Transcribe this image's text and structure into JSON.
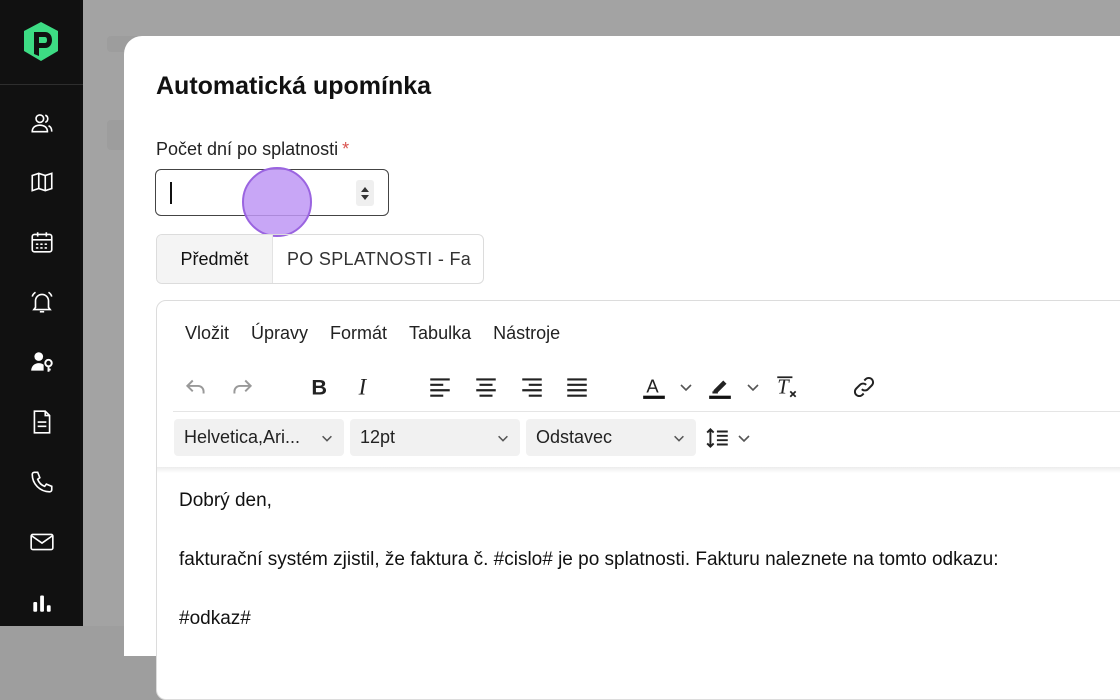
{
  "sidebar": {
    "logo": "logo-mark",
    "items": [
      {
        "icon": "users-icon"
      },
      {
        "icon": "map-icon"
      },
      {
        "icon": "calendar-icon"
      },
      {
        "icon": "bell-icon"
      },
      {
        "icon": "user-key-icon"
      },
      {
        "icon": "document-icon"
      },
      {
        "icon": "phone-icon"
      },
      {
        "icon": "mail-icon"
      },
      {
        "icon": "bar-chart-icon"
      }
    ]
  },
  "modal": {
    "title": "Automatická upomínka",
    "days_field": {
      "label": "Počet dní po splatnosti",
      "required_mark": "*",
      "value": ""
    },
    "subject": {
      "addon_label": "Předmět",
      "value": "PO SPLATNOSTI - Fa"
    },
    "editor": {
      "menu": [
        "Vložit",
        "Úpravy",
        "Formát",
        "Tabulka",
        "Nástroje"
      ],
      "font_family": "Helvetica,Ari...",
      "font_size": "12pt",
      "block_format": "Odstavec",
      "content": {
        "line1": "Dobrý den,",
        "line2": "fakturační systém zjistil, že faktura č. #cislo# je po splatnosti. Fakturu naleznete na tomto odkazu:",
        "line3": "#odkaz#"
      }
    }
  },
  "colors": {
    "sidebar_bg": "#111111",
    "logo_green": "#3ddc84",
    "click_indicator": "#be96f5",
    "required": "#d9534f"
  }
}
